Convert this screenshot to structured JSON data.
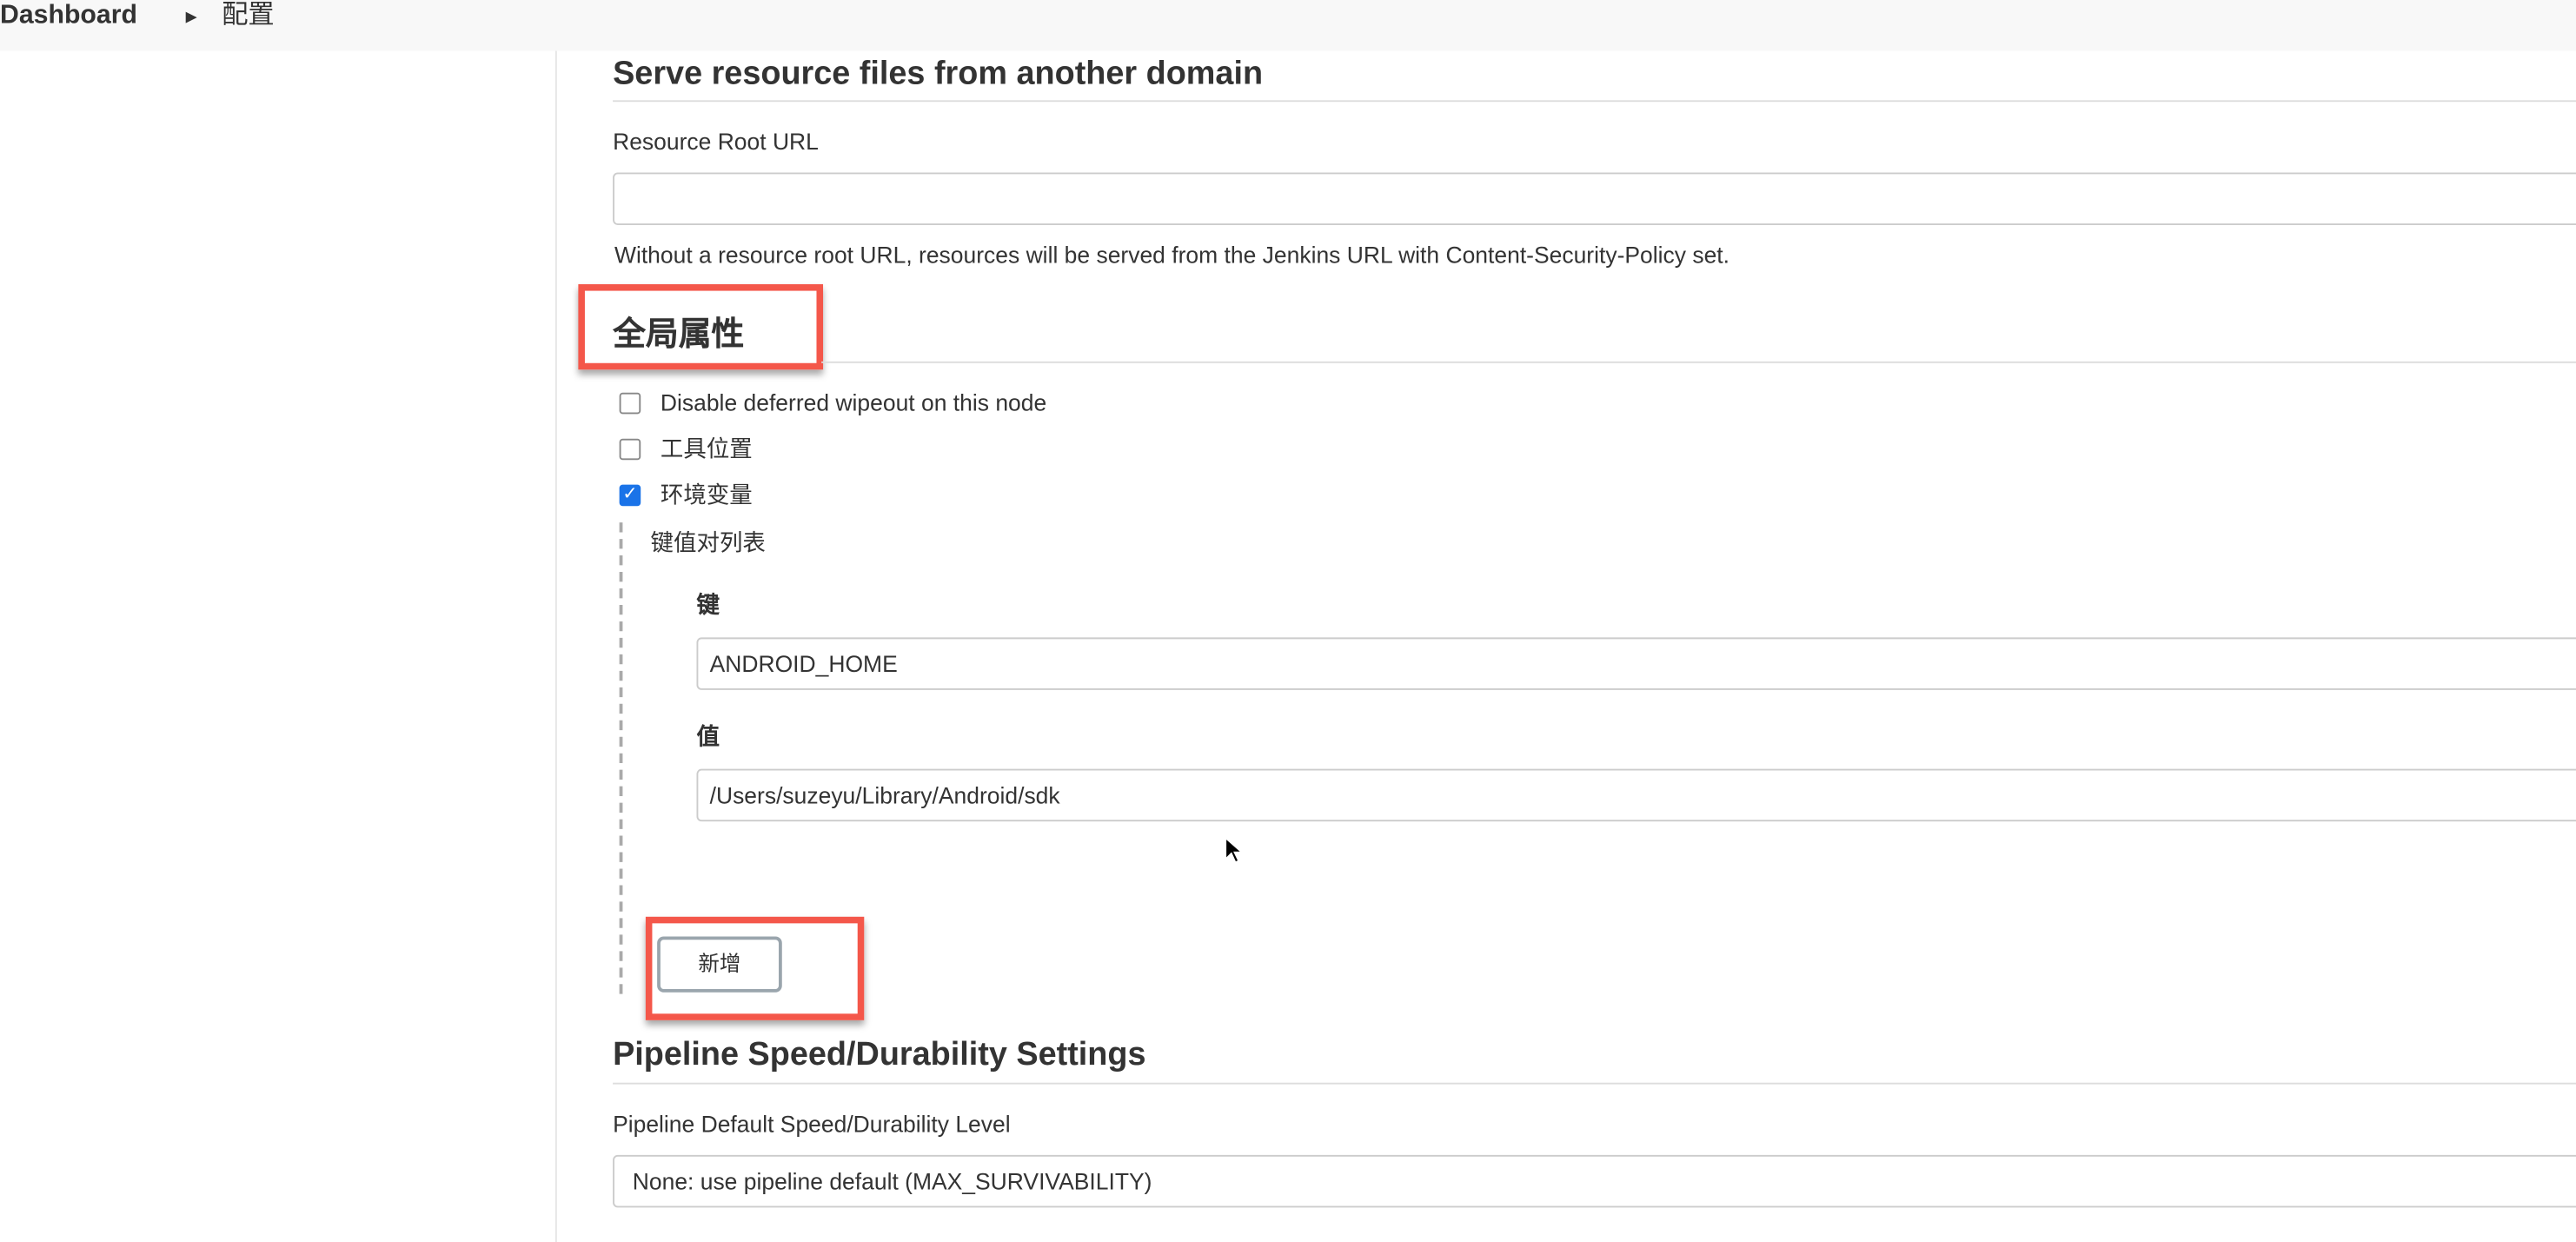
{
  "breadcrumb": {
    "items": [
      "Dashboard",
      "配置"
    ]
  },
  "resource_section": {
    "title": "Serve resource files from another domain",
    "field_label": "Resource Root URL",
    "field_value": "",
    "help": "Without a resource root URL, resources will be served from the Jenkins URL with Content-Security-Policy set."
  },
  "global_props": {
    "title": "全局属性",
    "checkboxes": [
      {
        "label": "Disable deferred wipeout on this node",
        "checked": false
      },
      {
        "label": "工具位置",
        "checked": false
      },
      {
        "label": "环境变量",
        "checked": true
      }
    ],
    "kv_list_label": "键值对列表",
    "key_label": "键",
    "key_value": "ANDROID_HOME",
    "value_label": "值",
    "value_value": "/Users/suzeyu/Library/Android/sdk",
    "add_button": "新增"
  },
  "pipeline": {
    "title": "Pipeline Speed/Durability Settings",
    "field_label": "Pipeline Default Speed/Durability Level",
    "selected": "None: use pipeline default (MAX_SURVIVABILITY)"
  },
  "colors": {
    "highlight": "#f4574a",
    "checkbox_checked": "#1a73e8"
  }
}
